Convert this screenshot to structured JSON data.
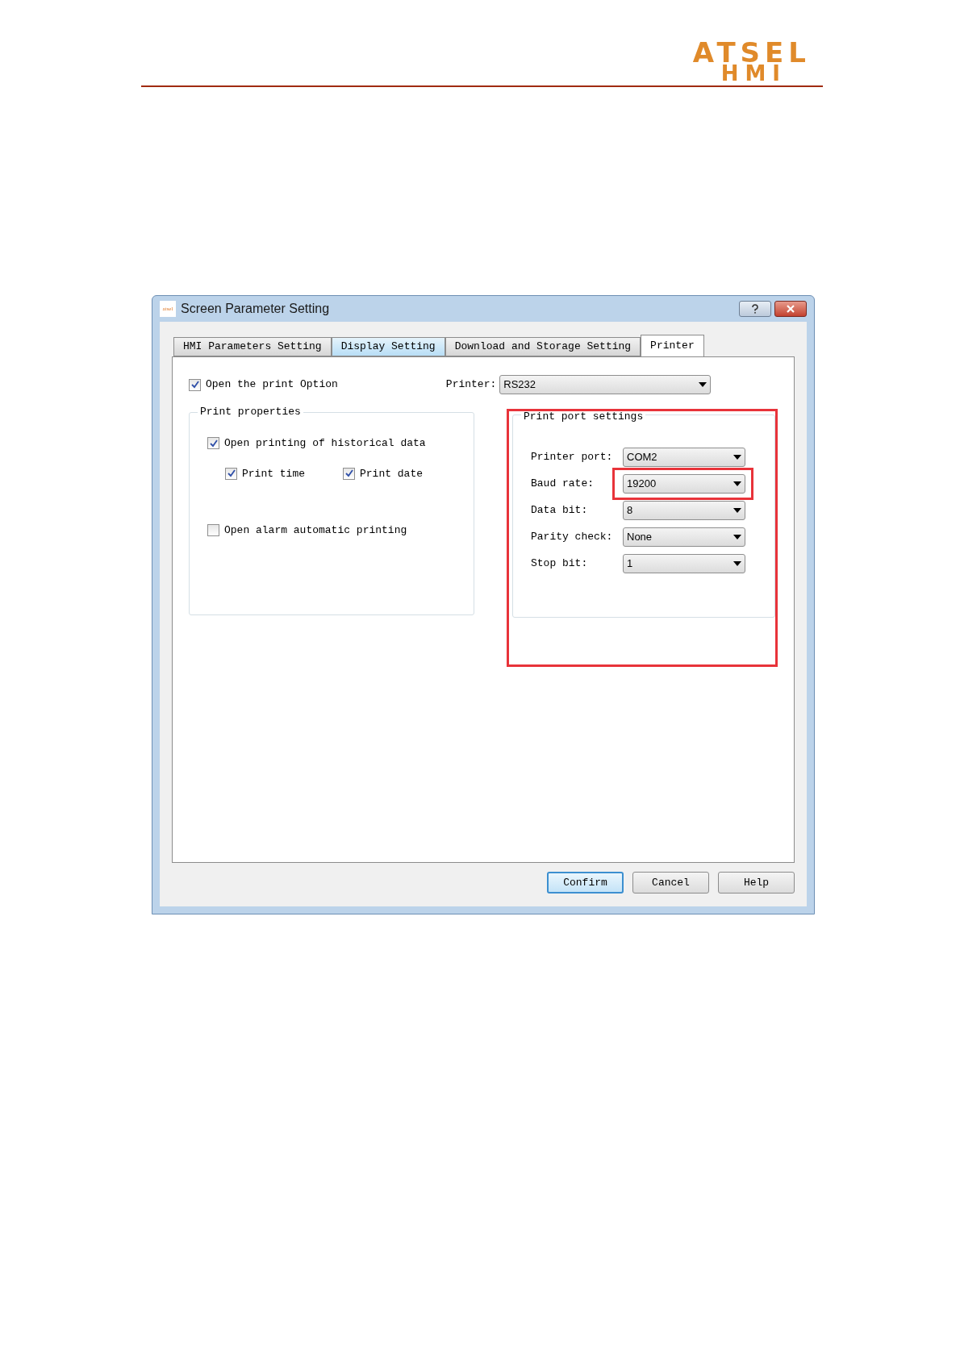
{
  "header": {
    "logo_top": "ATSEL",
    "logo_bottom": "HMI"
  },
  "dialog": {
    "title": "Screen Parameter Setting",
    "app_icon_text": "atsel",
    "tabs": [
      {
        "label": "HMI Parameters Setting",
        "selected": false,
        "hovered": false
      },
      {
        "label": "Display Setting",
        "selected": false,
        "hovered": true
      },
      {
        "label": "Download and Storage Setting",
        "selected": false,
        "hovered": false
      },
      {
        "label": "Printer",
        "selected": true,
        "hovered": false
      }
    ],
    "open_print_option": {
      "label": "Open the print Option",
      "checked": true
    },
    "printer": {
      "label": "Printer:",
      "value": "RS232"
    },
    "print_properties": {
      "title": "Print properties",
      "historical": {
        "label": "Open printing of historical data",
        "checked": true
      },
      "sub_options": [
        {
          "label": "Print time",
          "checked": true
        },
        {
          "label": "Print date",
          "checked": true
        }
      ],
      "alarm": {
        "label": "Open alarm automatic printing",
        "checked": false
      }
    },
    "port_settings": {
      "title": "Print port settings",
      "highlighted": true,
      "fields": [
        {
          "label": "Printer port:",
          "value": "COM2",
          "highlighted": false
        },
        {
          "label": "Baud rate:",
          "value": "19200",
          "highlighted": true
        },
        {
          "label": "Data bit:",
          "value": "8",
          "highlighted": false
        },
        {
          "label": "Parity check:",
          "value": "None",
          "highlighted": false
        },
        {
          "label": "Stop bit:",
          "value": "1",
          "highlighted": false
        }
      ]
    },
    "buttons": [
      {
        "label": "Confirm",
        "default": true
      },
      {
        "label": "Cancel",
        "default": false
      },
      {
        "label": "Help",
        "default": false
      }
    ]
  }
}
